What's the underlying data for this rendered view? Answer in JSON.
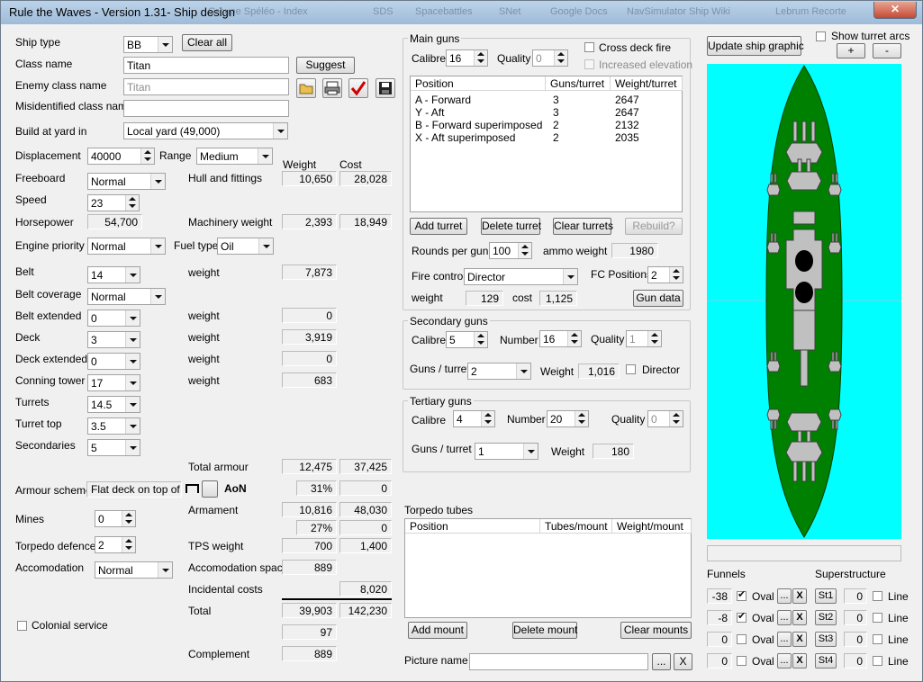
{
  "window": {
    "title": "Rule the Waves - Version 1.31- Ship design",
    "bg_taskbar_items": [
      "Groupe Spéléo - Index",
      "SDS",
      "Spacebattles",
      "SNet",
      "Google Docs",
      "NavSimulator Ship Wiki",
      "Lebrum Recorte"
    ]
  },
  "left": {
    "ship_type_label": "Ship type",
    "ship_type": "BB",
    "clear_all": "Clear all",
    "class_name_label": "Class name",
    "class_name": "Titan",
    "suggest": "Suggest",
    "enemy_class_label": "Enemy class name",
    "enemy_class": "Titan",
    "misid_label": "Misidentified class name",
    "misid": "",
    "yard_label": "Build at yard in",
    "yard": "Local yard (49,000)",
    "displacement_label": "Displacement",
    "displacement": "40000",
    "range_label": "Range",
    "range": "Medium",
    "weight_hdr": "Weight",
    "cost_hdr": "Cost",
    "freeboard_label": "Freeboard",
    "freeboard": "Normal",
    "hull_label": "Hull and fittings",
    "hull_weight": "10,650",
    "hull_cost": "28,028",
    "speed_label": "Speed",
    "speed": "23",
    "hp_label": "Horsepower",
    "hp": "54,700",
    "mach_label": "Machinery weight",
    "mach_weight": "2,393",
    "mach_cost": "18,949",
    "engine_label": "Engine priority",
    "engine": "Normal",
    "fuel_label": "Fuel type",
    "fuel": "Oil",
    "belt_label": "Belt",
    "belt": "14",
    "belt_w_label": "weight",
    "belt_weight": "7,873",
    "belt_cov_label": "Belt coverage",
    "belt_cov": "Normal",
    "belt_ext_label": "Belt extended",
    "belt_ext": "0",
    "belt_ext_w_label": "weight",
    "belt_ext_weight": "0",
    "deck_label": "Deck",
    "deck": "3",
    "deck_w_label": "weight",
    "deck_weight": "3,919",
    "deck_ext_label": "Deck extended",
    "deck_ext": "0",
    "deck_ext_w_label": "weight",
    "deck_ext_weight": "0",
    "ct_label": "Conning tower",
    "ct": "17",
    "ct_w_label": "weight",
    "ct_weight": "683",
    "turrets_label": "Turrets",
    "turrets": "14.5",
    "turret_top_label": "Turret top",
    "turret_top": "3.5",
    "secondaries_label": "Secondaries",
    "secondaries": "5",
    "total_armour_label": "Total armour",
    "total_armour_w": "12,475",
    "total_armour_c": "37,425",
    "armour_scheme_label": "Armour scheme",
    "armour_scheme": "Flat deck on top of",
    "aon": "AoN",
    "armour_pct": "31%",
    "armour_pct_c": "0",
    "armament_label": "Armament",
    "armament_w": "10,816",
    "armament_c": "48,030",
    "armament_pct": "27%",
    "armament_pct_c": "0",
    "mines_label": "Mines",
    "mines": "0",
    "torp_def_label": "Torpedo defence",
    "torp_def": "2",
    "tps_label": "TPS weight",
    "tps_w": "700",
    "tps_c": "1,400",
    "accom_label": "Accomodation",
    "accom": "Normal",
    "accom_space_label": "Accomodation space",
    "accom_space": "889",
    "incid_label": "Incidental costs",
    "incid": "8,020",
    "total_label": "Total",
    "total_w": "39,903",
    "total_c": "142,230",
    "colonial_label": "Colonial service",
    "extra_val": "97",
    "complement_label": "Complement",
    "complement": "889"
  },
  "main_guns": {
    "title": "Main guns",
    "calibre_label": "Calibre",
    "calibre": "16",
    "quality_label": "Quality",
    "quality": "0",
    "cross_deck": "Cross deck fire",
    "inc_elev": "Increased elevation",
    "col_position": "Position",
    "col_guns": "Guns/turret",
    "col_weight": "Weight/turret",
    "rows": [
      {
        "pos": "A - Forward",
        "guns": "3",
        "weight": "2647"
      },
      {
        "pos": "Y - Aft",
        "guns": "3",
        "weight": "2647"
      },
      {
        "pos": "B - Forward superimposed",
        "guns": "2",
        "weight": "2132"
      },
      {
        "pos": "X - Aft superimposed",
        "guns": "2",
        "weight": "2035"
      }
    ],
    "add_turret": "Add turret",
    "delete_turret": "Delete turret",
    "clear_turrets": "Clear turrets",
    "rebuild": "Rebuild?",
    "rounds_label": "Rounds per gun",
    "rounds": "100",
    "ammo_label": "ammo weight",
    "ammo": "1980",
    "fc_label": "Fire control",
    "fc": "Director",
    "fc_pos_label": "FC Positions",
    "fc_pos": "2",
    "w_label": "weight",
    "w": "129",
    "c_label": "cost",
    "c": "1,125",
    "gun_data": "Gun data"
  },
  "secondary": {
    "title": "Secondary guns",
    "calibre_label": "Calibre",
    "calibre": "5",
    "number_label": "Number",
    "number": "16",
    "quality_label": "Quality",
    "quality": "1",
    "gpt_label": "Guns / turret",
    "gpt": "2",
    "weight_label": "Weight",
    "weight": "1,016",
    "director": "Director"
  },
  "tertiary": {
    "title": "Tertiary guns",
    "calibre_label": "Calibre",
    "calibre": "4",
    "number_label": "Number",
    "number": "20",
    "quality_label": "Quality",
    "quality": "0",
    "gpt_label": "Guns / turret",
    "gpt": "1",
    "weight_label": "Weight",
    "weight": "180"
  },
  "torpedo": {
    "title": "Torpedo tubes",
    "col_position": "Position",
    "col_tubes": "Tubes/mount",
    "col_weight": "Weight/mount",
    "add_mount": "Add mount",
    "delete_mount": "Delete mount",
    "clear_mounts": "Clear mounts"
  },
  "picture": {
    "label": "Picture name",
    "value": "",
    "browse": "...",
    "clear": "X"
  },
  "right": {
    "update": "Update ship graphic",
    "show_arcs": "Show turret arcs",
    "plus": "+",
    "minus": "-",
    "funnels_label": "Funnels",
    "super_label": "Superstructure",
    "funnels": [
      {
        "v": "-38",
        "oval": "Oval",
        "on": true,
        "st": "St1",
        "sv": "0",
        "line": "Line"
      },
      {
        "v": "-8",
        "oval": "Oval",
        "on": true,
        "st": "St2",
        "sv": "0",
        "line": "Line"
      },
      {
        "v": "0",
        "oval": "Oval",
        "on": false,
        "st": "St3",
        "sv": "0",
        "line": "Line"
      },
      {
        "v": "0",
        "oval": "Oval",
        "on": false,
        "st": "St4",
        "sv": "0",
        "line": "Line"
      }
    ],
    "dots": "...",
    "x": "X",
    "colors": {
      "sea": "#00ffff",
      "hull": "#008000",
      "deck_items": "#c0c0c0",
      "funnel": "#000000"
    }
  }
}
